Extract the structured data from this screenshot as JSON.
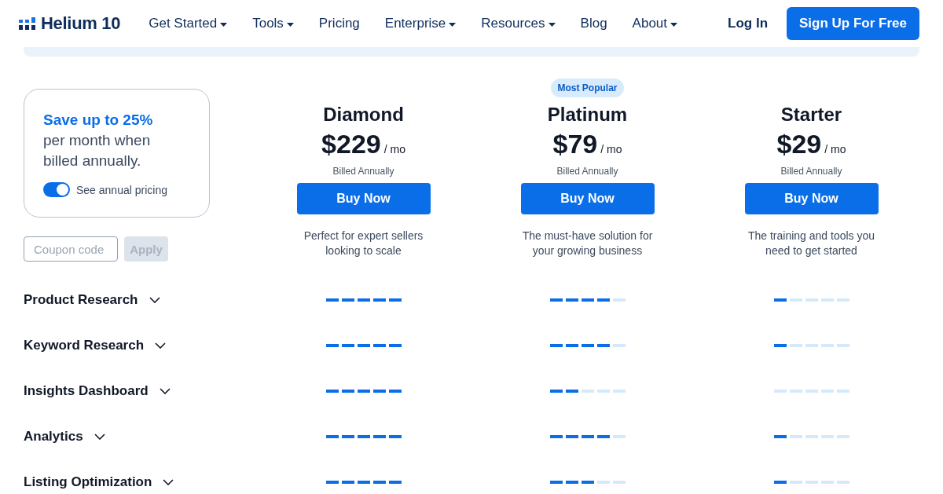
{
  "header": {
    "logo": "Helium 10",
    "nav": [
      {
        "label": "Get Started",
        "dropdown": true
      },
      {
        "label": "Tools",
        "dropdown": true
      },
      {
        "label": "Pricing",
        "dropdown": false
      },
      {
        "label": "Enterprise",
        "dropdown": true
      },
      {
        "label": "Resources",
        "dropdown": true
      },
      {
        "label": "Blog",
        "dropdown": false
      },
      {
        "label": "About",
        "dropdown": true
      }
    ],
    "login": "Log In",
    "signup": "Sign Up For Free"
  },
  "promo": {
    "headline": "Save up to 25%",
    "text": "per month when billed annually.",
    "toggle": {
      "label": "See annual pricing",
      "on": true
    }
  },
  "coupon": {
    "placeholder": "Coupon code",
    "button": "Apply",
    "button_disabled": true
  },
  "plans": [
    {
      "name": "Diamond",
      "price": "$229",
      "period": "/ mo",
      "billing": "Billed Annually",
      "button": "Buy Now",
      "description": "Perfect for expert sellers looking to scale"
    },
    {
      "badge": "Most Popular",
      "name": "Platinum",
      "price": "$79",
      "period": "/ mo",
      "billing": "Billed Annually",
      "button": "Buy Now",
      "description": "The must-have solution for your growing business"
    },
    {
      "name": "Starter",
      "price": "$29",
      "period": "/ mo",
      "billing": "Billed Annually",
      "button": "Buy Now",
      "description": "The training and tools you need to get started"
    }
  ],
  "features": [
    {
      "name": "Product Research",
      "expanded": false,
      "ratings": [
        {
          "level": 1
        },
        {
          "level": 0.8
        },
        {
          "level": 0.2
        }
      ]
    },
    {
      "name": "Keyword Research",
      "expanded": false,
      "ratings": [
        {
          "level": 1
        },
        {
          "level": 0.8
        },
        {
          "level": 0.2
        }
      ]
    },
    {
      "name": "Insights Dashboard",
      "expanded": false,
      "ratings": [
        {
          "level": 1
        },
        {
          "level": 0.4
        },
        {
          "level": 0
        }
      ]
    },
    {
      "name": "Analytics",
      "expanded": false,
      "ratings": [
        {
          "level": 1
        },
        {
          "level": 0.8
        },
        {
          "level": 0.2
        }
      ]
    },
    {
      "name": "Listing Optimization",
      "expanded": false,
      "ratings": [
        {
          "level": 1
        },
        {
          "level": 0.6
        },
        {
          "level": 0.2
        }
      ]
    }
  ]
}
